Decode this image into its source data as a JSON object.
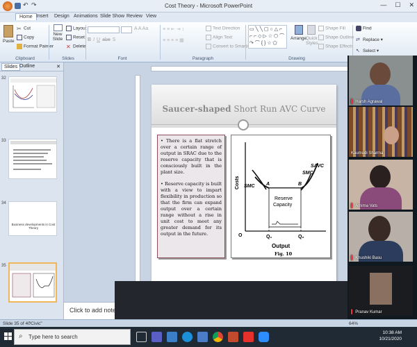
{
  "window": {
    "title": "Cost Theory - Microsoft PowerPoint",
    "min": "—",
    "max": "☐",
    "close": "✕"
  },
  "ribbon_tabs": [
    "Home",
    "Insert",
    "Design",
    "Animations",
    "Slide Show",
    "Review",
    "View"
  ],
  "ribbon": {
    "paste": "Paste",
    "cut": "Cut",
    "copy": "Copy",
    "format_painter": "Format Painter",
    "new_slide": "New Slide",
    "layout": "Layout",
    "reset": "Reset",
    "delete": "Delete",
    "text_direction": "Text Direction",
    "align_text": "Align Text",
    "convert_smartart": "Convert to SmartArt",
    "arrange": "Arrange",
    "quick_styles": "Quick Styles",
    "shape_fill": "Shape Fill",
    "shape_outline": "Shape Outline",
    "shape_effects": "Shape Effects",
    "find": "Find",
    "replace": "Replace",
    "select": "Select",
    "groups": {
      "clipboard": "Clipboard",
      "slides": "Slides",
      "font": "Font",
      "paragraph": "Paragraph",
      "drawing": "Drawing"
    }
  },
  "left_pane": {
    "tabs": [
      "Slides",
      "Outline"
    ],
    "thumbs": [
      {
        "num": "32",
        "text": ""
      },
      {
        "num": "33",
        "text": ""
      },
      {
        "num": "34",
        "text": "Business developments in Cost Theory"
      },
      {
        "num": "35",
        "text": ""
      }
    ]
  },
  "slide": {
    "title_bold": "Saucer-shaped",
    "title_rest": " Short Run AVC Curve",
    "bullets": [
      "• There is a flat stretch over a certain range of output in SRAC due to the reserve capacity that is consciously built in the plant size.",
      "• Reserve capacity is built with a view to impart flexibility in production so that the firm can expand output over a certain range without a rise in unit cost to meet any greater demand for its output in the future."
    ],
    "diagram": {
      "costs": "Costs",
      "output": "Output",
      "origin": "O",
      "q1": "Q₁",
      "q2": "Q₂",
      "a": "A",
      "b": "B",
      "smc_left": "SMC",
      "smc_right": "SMC",
      "savc": "SAVC",
      "reserve1": "Reserve",
      "reserve2": "Capacity",
      "fig": "Fig. 10"
    }
  },
  "notes_placeholder": "Click to add notes",
  "participants": [
    {
      "name": "Harsh Agrawal"
    },
    {
      "name": "Kaumudi Sharma"
    },
    {
      "name": "Amima Vats"
    },
    {
      "name": "Khushiki Basu"
    },
    {
      "name": "Pranav Kumar"
    }
  ],
  "status": {
    "slide_info": "Slide 35 of 40",
    "theme": "\"Civic\"",
    "zoom": "64%"
  },
  "taskbar": {
    "search_placeholder": "Type here to search",
    "time": "10:38 AM",
    "date": "10/21/2020"
  }
}
